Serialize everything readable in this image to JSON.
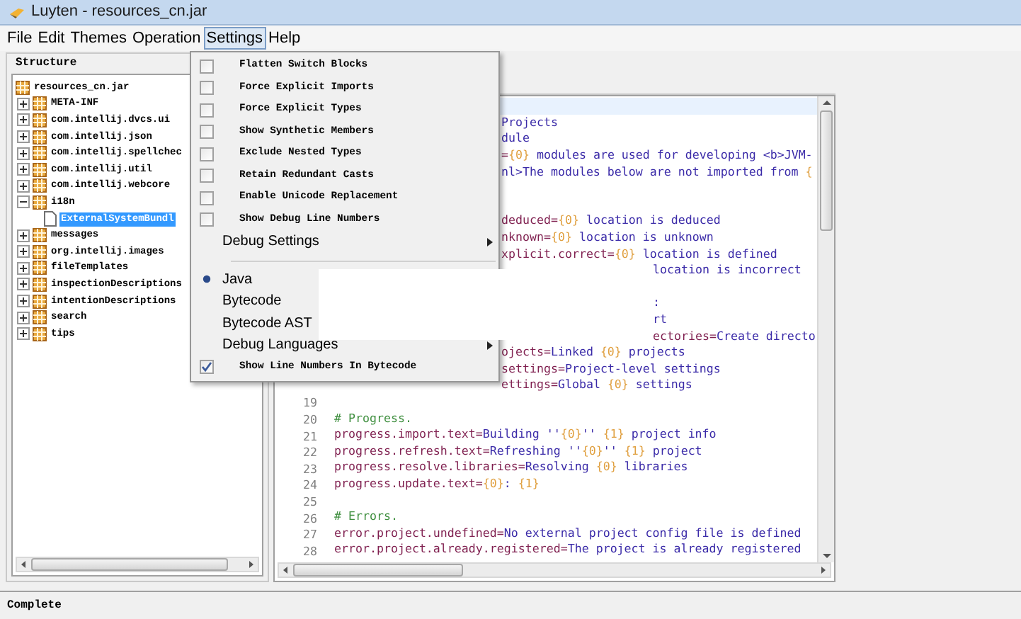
{
  "window": {
    "title": "Luyten - resources_cn.jar"
  },
  "menu_bar": [
    {
      "label": "File",
      "selected": false
    },
    {
      "label": "Edit",
      "selected": false
    },
    {
      "label": "Themes",
      "selected": false
    },
    {
      "label": "Operation",
      "selected": false
    },
    {
      "label": "Settings",
      "selected": true
    },
    {
      "label": "Help",
      "selected": false
    }
  ],
  "structure": {
    "title": "Structure",
    "nodes": [
      {
        "label": "resources_cn.jar",
        "kind": "package",
        "selected": false,
        "children": [
          {
            "label": "META-INF",
            "kind": "package",
            "expanded": false,
            "selected": false
          },
          {
            "label": "com.intellij.dvcs.ui",
            "kind": "package",
            "expanded": false,
            "selected": false
          },
          {
            "label": "com.intellij.json",
            "kind": "package",
            "expanded": false,
            "selected": false
          },
          {
            "label": "com.intellij.spellchec",
            "kind": "package",
            "expanded": false,
            "selected": false
          },
          {
            "label": "com.intellij.util",
            "kind": "package",
            "expanded": false,
            "selected": false
          },
          {
            "label": "com.intellij.webcore",
            "kind": "package",
            "expanded": false,
            "selected": false
          },
          {
            "label": "i18n",
            "kind": "package",
            "expanded": true,
            "selected": false,
            "children": [
              {
                "label": "ExternalSystemBundl",
                "kind": "file",
                "selected": true
              }
            ]
          },
          {
            "label": "messages",
            "kind": "package",
            "expanded": false,
            "selected": false
          },
          {
            "label": "org.intellij.images",
            "kind": "package",
            "expanded": false,
            "selected": false
          },
          {
            "label": "fileTemplates",
            "kind": "package",
            "expanded": false,
            "selected": false
          },
          {
            "label": "inspectionDescriptions",
            "kind": "package",
            "expanded": false,
            "selected": false
          },
          {
            "label": "intentionDescriptions",
            "kind": "package",
            "expanded": false,
            "selected": false
          },
          {
            "label": "search",
            "kind": "package",
            "expanded": false,
            "selected": false
          },
          {
            "label": "tips",
            "kind": "package",
            "expanded": false,
            "selected": false
          }
        ]
      }
    ]
  },
  "settings_menu": [
    {
      "kind": "checkbox",
      "label": "Flatten Switch Blocks",
      "checked": false
    },
    {
      "kind": "checkbox",
      "label": "Force Explicit Imports",
      "checked": false
    },
    {
      "kind": "checkbox",
      "label": "Force Explicit Types",
      "checked": false
    },
    {
      "kind": "checkbox",
      "label": "Show Synthetic Members",
      "checked": false
    },
    {
      "kind": "checkbox",
      "label": "Exclude Nested Types",
      "checked": false
    },
    {
      "kind": "checkbox",
      "label": "Retain Redundant Casts",
      "checked": false
    },
    {
      "kind": "checkbox",
      "label": "Enable Unicode Replacement",
      "checked": false
    },
    {
      "kind": "checkbox",
      "label": "Show Debug Line Numbers",
      "checked": false
    },
    {
      "kind": "submenu",
      "label": "Debug Settings"
    },
    {
      "kind": "separator"
    },
    {
      "kind": "radio",
      "label": "Java",
      "selected": true
    },
    {
      "kind": "radio",
      "label": "Bytecode",
      "selected": false
    },
    {
      "kind": "radio",
      "label": "Bytecode AST",
      "selected": false
    },
    {
      "kind": "submenu",
      "label": "Debug Languages"
    },
    {
      "kind": "checkbox",
      "label": "Show Line Numbers In Bytecode",
      "checked": true
    }
  ],
  "editor": {
    "lines": [
      {
        "kind": "after_menu",
        "current": true
      },
      {
        "kind": "after_menu",
        "text": "Projects",
        "current": false
      },
      {
        "kind": "after_menu",
        "text": "dule",
        "current": false
      },
      {
        "kind": "after_menu",
        "text": "={0} modules are used for developing <b>JVM-",
        "current": false
      },
      {
        "kind": "after_menu",
        "text": "nl>The modules below are not imported from {",
        "current": false
      },
      {
        "kind": "after_menu",
        "current": false
      },
      {
        "kind": "after_menu",
        "current": false
      },
      {
        "kind": "after_menu",
        "text": "deduced={0} location is deduced",
        "current": false
      },
      {
        "kind": "after_menu",
        "text": "nknown={0} location is unknown",
        "current": false
      },
      {
        "kind": "after_menu",
        "text": "xplicit.correct={0} location is defined",
        "current": false
      },
      {
        "kind": "after_popup",
        "text": "location is incorrect",
        "current": false
      },
      {
        "kind": "after_popup",
        "current": false
      },
      {
        "kind": "after_popup",
        "text": ":",
        "current": false
      },
      {
        "kind": "after_popup",
        "text": "rt",
        "current": false
      },
      {
        "kind": "after_popup",
        "text": "ectories=Create directo",
        "current": false
      },
      {
        "kind": "after_menu",
        "text": "ojects=Linked {0} projects",
        "current": false
      },
      {
        "kind": "after_menu",
        "text": "settings=Project-level settings",
        "current": false
      },
      {
        "kind": "after_menu",
        "text": "ettings=Global {0} settings",
        "current": false
      },
      {
        "kind": "full",
        "number": "19",
        "current": false
      },
      {
        "kind": "full",
        "number": "20",
        "text": "# Progress.",
        "current": false
      },
      {
        "kind": "full",
        "number": "21",
        "text": "progress.import.text=Building ''{0}'' {1} project info",
        "current": false
      },
      {
        "kind": "full",
        "number": "22",
        "text": "progress.refresh.text=Refreshing ''{0}'' {1} project",
        "current": false
      },
      {
        "kind": "full",
        "number": "23",
        "text": "progress.resolve.libraries=Resolving {0} libraries",
        "current": false
      },
      {
        "kind": "full",
        "number": "24",
        "text": "progress.update.text={0}: {1}",
        "current": false
      },
      {
        "kind": "full",
        "number": "25",
        "current": false
      },
      {
        "kind": "full",
        "number": "26",
        "text": "# Errors.",
        "current": false
      },
      {
        "kind": "full",
        "number": "27",
        "text": "error.project.undefined=No external project config file is defined",
        "current": false
      },
      {
        "kind": "full",
        "number": "28",
        "text": "error.project.already.registered=The project is already registered",
        "current": false
      }
    ]
  },
  "status_bar": {
    "text": "Complete"
  }
}
